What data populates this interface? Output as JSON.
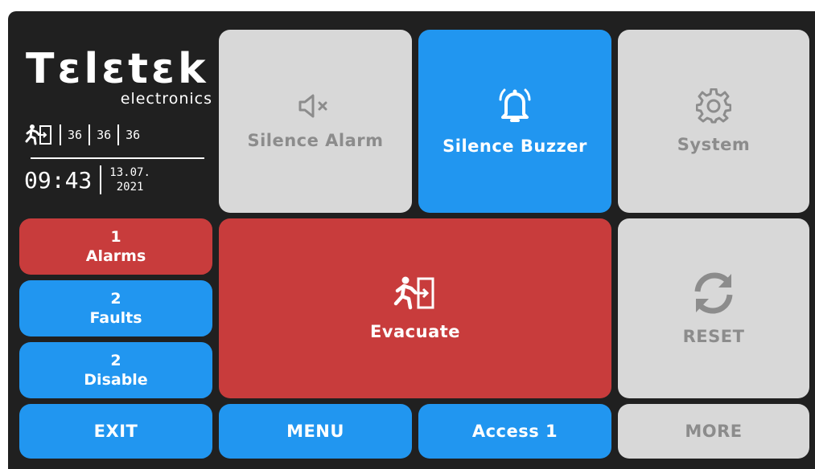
{
  "brand": {
    "name": "Tεlεtεk",
    "subtitle": "electronics"
  },
  "status": {
    "values": [
      "36",
      "36",
      "36"
    ],
    "time": "09:43",
    "date_line1": "13.07.",
    "date_line2": "2021"
  },
  "buttons": {
    "silence_alarm": "Silence Alarm",
    "silence_buzzer": "Silence Buzzer",
    "system": "System",
    "evacuate": "Evacuate",
    "reset": "RESET",
    "exit": "EXIT",
    "menu": "MENU",
    "access": "Access 1",
    "more": "MORE"
  },
  "counters": {
    "alarms": {
      "count": "1",
      "label": "Alarms"
    },
    "faults": {
      "count": "2",
      "label": "Faults"
    },
    "disable": {
      "count": "2",
      "label": "Disable"
    }
  },
  "icons": {
    "silence_alarm": "speaker-mute-icon",
    "silence_buzzer": "bell-icon",
    "system": "gear-icon",
    "evacuate": "running-exit-icon",
    "reset": "refresh-icon"
  },
  "colors": {
    "blue": "#2196f0",
    "red": "#c83c3c",
    "grey": "#d8d8d8",
    "background": "#202020"
  }
}
